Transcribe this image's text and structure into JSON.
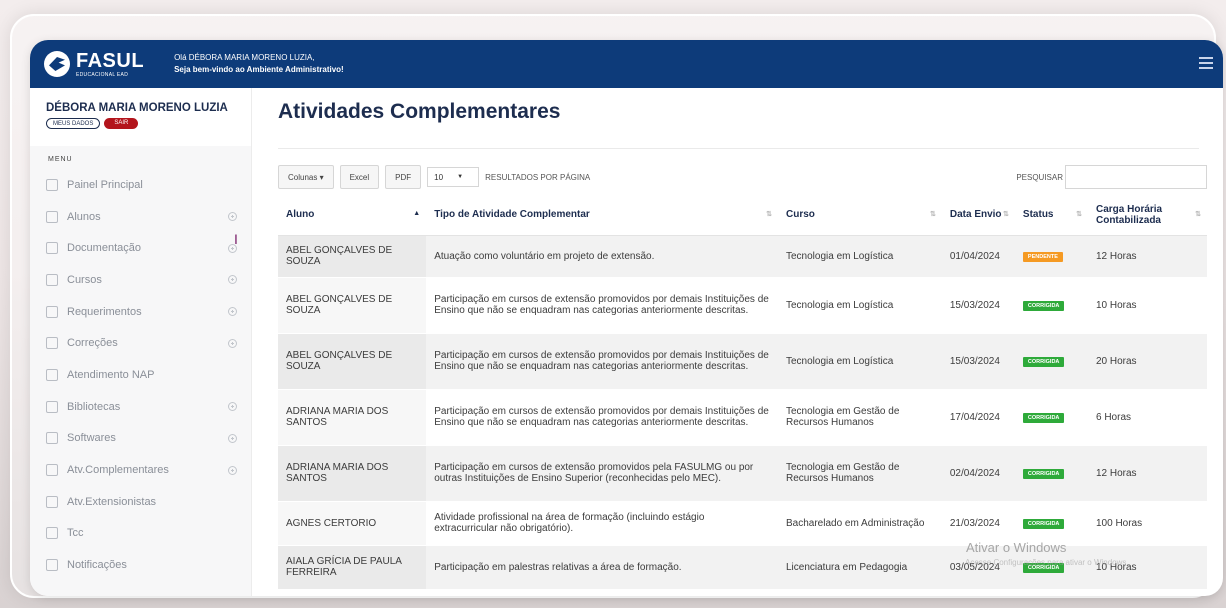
{
  "header": {
    "logo_text": "FASUL",
    "logo_sub": "EDUCACIONAL EAD",
    "welcome_line1": "Olá DÉBORA MARIA MORENO LUZIA,",
    "welcome_line2": "Seja bem-vindo ao Ambiente Administrativo!"
  },
  "user": {
    "name": "DÉBORA MARIA MORENO LUZIA",
    "dados_label": "MEUS DADOS",
    "sair_label": "SAIR"
  },
  "sidebar": {
    "menu_title": "MENU",
    "items": [
      {
        "label": "Painel Principal",
        "icon": "dashboard-icon",
        "expandable": false
      },
      {
        "label": "Alunos",
        "icon": "user-icon",
        "expandable": true
      },
      {
        "label": "Documentação",
        "icon": "document-icon",
        "expandable": true
      },
      {
        "label": "Cursos",
        "icon": "graduation-icon",
        "expandable": true
      },
      {
        "label": "Requerimentos",
        "icon": "form-icon",
        "expandable": true
      },
      {
        "label": "Correções",
        "icon": "filter-icon",
        "expandable": true
      },
      {
        "label": "Atendimento NAP",
        "icon": "support-icon",
        "expandable": false
      },
      {
        "label": "Bibliotecas",
        "icon": "library-icon",
        "expandable": true
      },
      {
        "label": "Softwares",
        "icon": "software-icon",
        "expandable": true
      },
      {
        "label": "Atv.Complementares",
        "icon": "activity-icon",
        "expandable": true
      },
      {
        "label": "Atv.Extensionistas",
        "icon": "extension-icon",
        "expandable": false
      },
      {
        "label": "Tcc",
        "icon": "tcc-icon",
        "expandable": false
      },
      {
        "label": "Notificações",
        "icon": "bell-icon",
        "expandable": false
      }
    ]
  },
  "main": {
    "title": "Atividades Complementares",
    "toolbar": {
      "columns_label": "Colunas ▾",
      "excel_label": "Excel",
      "pdf_label": "PDF",
      "per_page_value": "10",
      "per_page_label": "RESULTADOS POR PÁGINA",
      "search_label": "PESQUISAR",
      "search_value": ""
    },
    "table": {
      "headers": {
        "aluno": "Aluno",
        "tipo": "Tipo de Atividade Complementar",
        "curso": "Curso",
        "data": "Data Envio",
        "status": "Status",
        "carga": "Carga Horária Contabilizada"
      },
      "rows": [
        {
          "aluno": "ABEL GONÇALVES DE SOUZA",
          "tipo": "Atuação como voluntário em projeto de extensão.",
          "curso": "Tecnologia em Logística",
          "data": "01/04/2024",
          "status": "PENDENTE",
          "status_type": "pend",
          "carga": "12 Horas"
        },
        {
          "aluno": "ABEL GONÇALVES DE SOUZA",
          "tipo": "Participação em cursos de extensão promovidos por demais Instituições de Ensino que não se enquadram nas categorias anteriormente descritas.",
          "curso": "Tecnologia em Logística",
          "data": "15/03/2024",
          "status": "CORRIGIDA",
          "status_type": "corr",
          "carga": "10 Horas"
        },
        {
          "aluno": "ABEL GONÇALVES DE SOUZA",
          "tipo": "Participação em cursos de extensão promovidos por demais Instituições de Ensino que não se enquadram nas categorias anteriormente descritas.",
          "curso": "Tecnologia em Logística",
          "data": "15/03/2024",
          "status": "CORRIGIDA",
          "status_type": "corr",
          "carga": "20 Horas"
        },
        {
          "aluno": "ADRIANA MARIA DOS SANTOS",
          "tipo": "Participação em cursos de extensão promovidos por demais Instituições de Ensino que não se enquadram nas categorias anteriormente descritas.",
          "curso": "Tecnologia em Gestão de Recursos Humanos",
          "data": "17/04/2024",
          "status": "CORRIGIDA",
          "status_type": "corr",
          "carga": "6 Horas"
        },
        {
          "aluno": "ADRIANA MARIA DOS SANTOS",
          "tipo": "Participação em cursos de extensão promovidos pela FASULMG ou por outras Instituições de Ensino Superior (reconhecidas pelo MEC).",
          "curso": "Tecnologia em Gestão de Recursos Humanos",
          "data": "02/04/2024",
          "status": "CORRIGIDA",
          "status_type": "corr",
          "carga": "12 Horas"
        },
        {
          "aluno": "AGNES CERTORIO",
          "tipo": "Atividade profissional na área de formação (incluindo estágio extracurricular não obrigatório).",
          "curso": "Bacharelado em Administração",
          "data": "21/03/2024",
          "status": "CORRIGIDA",
          "status_type": "corr",
          "carga": "100 Horas"
        },
        {
          "aluno": "AIALA GRÍCIA DE PAULA FERREIRA",
          "tipo": "Participação em palestras relativas a área de formação.",
          "curso": "Licenciatura em Pedagogia",
          "data": "03/05/2024",
          "status": "CORRIGIDA",
          "status_type": "corr",
          "carga": "10 Horas"
        }
      ]
    }
  },
  "watermark": {
    "line1": "Ativar o Windows",
    "line2": "Acesse Configurações para ativar o Windows."
  },
  "colors": {
    "header_bg": "#0d3b7a",
    "title": "#1d2d4f",
    "pendente": "#f59a23",
    "corrigida": "#2eaa3a",
    "sair": "#b3141c"
  }
}
